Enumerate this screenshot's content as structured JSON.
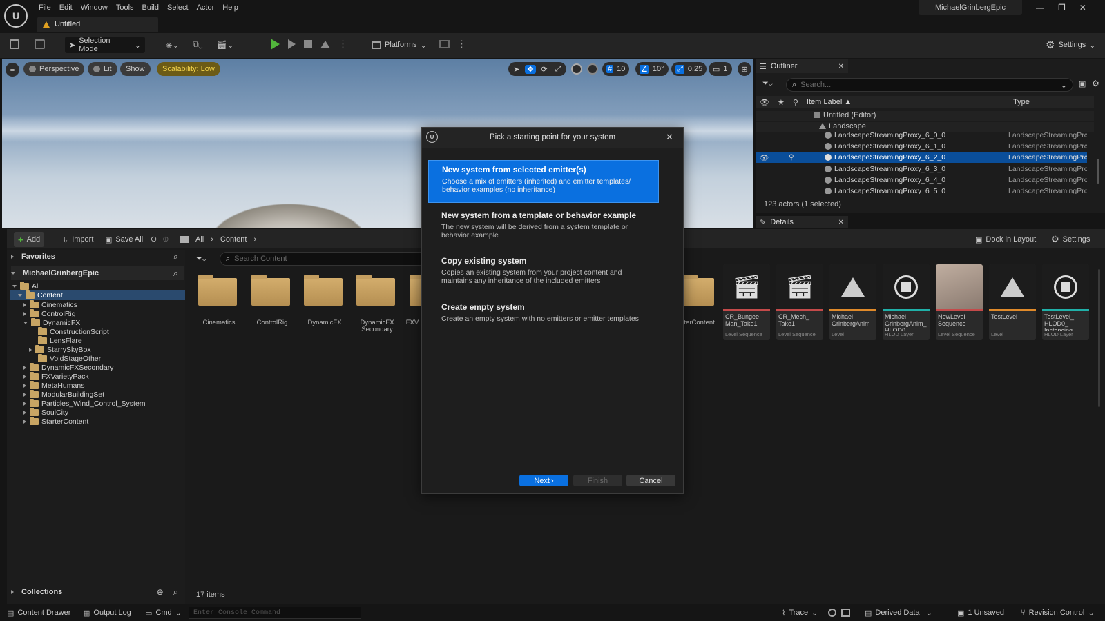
{
  "menu": [
    "File",
    "Edit",
    "Window",
    "Tools",
    "Build",
    "Select",
    "Actor",
    "Help"
  ],
  "account": "MichaelGrinbergEpic",
  "doc_tab": "Untitled",
  "toolbar": {
    "selection_mode": "Selection Mode",
    "platforms": "Platforms",
    "settings": "Settings"
  },
  "viewport": {
    "perspective": "Perspective",
    "lit": "Lit",
    "show": "Show",
    "scalability": "Scalability: Low",
    "grid": "10",
    "angle": "10°",
    "scale": "0.25",
    "camera": "1"
  },
  "outliner": {
    "title": "Outliner",
    "search_placeholder": "Search...",
    "col_label": "Item Label ▲",
    "col_type": "Type",
    "root": "Untitled (Editor)",
    "landscape": "Landscape",
    "rows": [
      {
        "name": "LandscapeStreamingProxy_6_0_0",
        "type": "LandscapeStreamingPrc"
      },
      {
        "name": "LandscapeStreamingProxy_6_1_0",
        "type": "LandscapeStreamingPrc"
      },
      {
        "name": "LandscapeStreamingProxy_6_2_0",
        "type": "LandscapeStreamingPrc"
      },
      {
        "name": "LandscapeStreamingProxy_6_3_0",
        "type": "LandscapeStreamingPrc"
      },
      {
        "name": "LandscapeStreamingProxy_6_4_0",
        "type": "LandscapeStreamingPrc"
      },
      {
        "name": "LandscapeStreamingProxy_6_5_0",
        "type": "LandscapeStreamingPrc"
      }
    ],
    "count": "123 actors (1 selected)"
  },
  "details": {
    "title": "Details",
    "dock": "Dock in Layout",
    "settings": "Settings"
  },
  "content": {
    "add": "Add",
    "import": "Import",
    "save_all": "Save All",
    "crumb_all": "All",
    "crumb_content": "Content",
    "search_placeholder": "Search Content",
    "favorites": "Favorites",
    "project": "MichaelGrinbergEpic",
    "tree": [
      "All",
      "Content",
      "Cinematics",
      "ControlRig",
      "DynamicFX",
      "ConstructionScript",
      "LensFlare",
      "StarrySkyBox",
      "VoidStageOther",
      "DynamicFXSecondary",
      "FXVarietyPack",
      "MetaHumans",
      "ModularBuildingSet",
      "Particles_Wind_Control_System",
      "SoulCity",
      "StarterContent"
    ],
    "folders": [
      "Cinematics",
      "ControlRig",
      "DynamicFX",
      "DynamicFX Secondary",
      "FXV",
      "rterContent"
    ],
    "assets": [
      {
        "name": "CR_Bungee Man_Take1",
        "type": "Level Sequence"
      },
      {
        "name": "CR_Mech_ Take1",
        "type": "Level Sequence"
      },
      {
        "name": "Michael GrinbergAnim",
        "type": "Level"
      },
      {
        "name": "Michael GrinbergAnim_ HLOD0",
        "type": "HLOD Layer"
      },
      {
        "name": "NewLevel Sequence",
        "type": "Level Sequence"
      },
      {
        "name": "TestLevel",
        "type": "Level"
      },
      {
        "name": "TestLevel_ HLOD0_ Instancing",
        "type": "HLOD Layer"
      }
    ],
    "collections": "Collections",
    "items": "17 items"
  },
  "dialog": {
    "title": "Pick a starting point for your system",
    "options": [
      {
        "title": "New system from selected emitter(s)",
        "desc": "Choose a mix of emitters (inherited) and emitter templates/ behavior examples (no inheritance)"
      },
      {
        "title": "New system from a template or behavior example",
        "desc": "The new system will be derived from a system template or behavior example"
      },
      {
        "title": "Copy existing system",
        "desc": "Copies an existing system from your project content and maintains any inheritance of the included emitters"
      },
      {
        "title": "Create empty system",
        "desc": "Create an empty system with no emitters or emitter templates"
      }
    ],
    "next": "Next",
    "finish": "Finish",
    "cancel": "Cancel"
  },
  "statusbar": {
    "content_drawer": "Content Drawer",
    "output_log": "Output Log",
    "cmd": "Cmd",
    "console_placeholder": "Enter Console Command",
    "trace": "Trace",
    "derived_data": "Derived Data",
    "unsaved": "1 Unsaved",
    "revision": "Revision Control"
  },
  "colors": {
    "accent": "#0a70e0",
    "scalability_bg": "#c5a300",
    "folder": "#c8a564",
    "level_sequence": "#c44a4a",
    "level": "#e08a2a",
    "hlod": "#20b0a8"
  }
}
